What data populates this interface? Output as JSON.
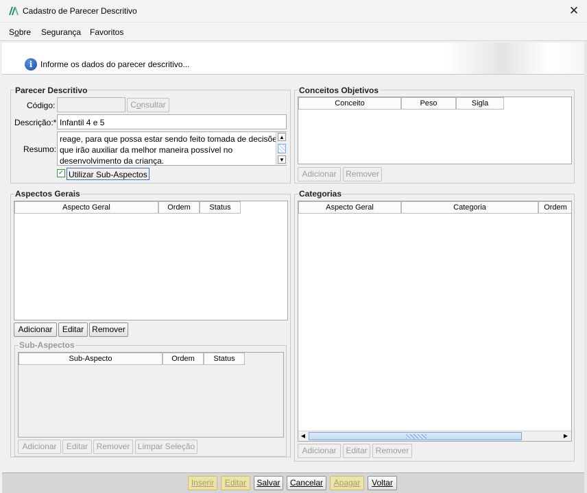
{
  "window": {
    "title": "Cadastro de Parecer Descritivo"
  },
  "menu": {
    "sobre_pre": "S",
    "sobre_ul": "o",
    "sobre_post": "bre",
    "seguranca": "Segurança",
    "favoritos": "Favoritos"
  },
  "info": {
    "text": "Informe os dados do parecer descritivo...",
    "icon_glyph": "i"
  },
  "parecer": {
    "legend": "Parecer Descritivo",
    "codigo_label": "Código:",
    "codigo_value": "",
    "consultar_pre": "C",
    "consultar_ul": "o",
    "consultar_post": "nsultar",
    "descricao_label": "Descrição:*",
    "descricao_value": "Infantil 4 e 5",
    "resumo_label": "Resumo:",
    "resumo_lines": [
      "reage, para que possa estar sendo feito tomada de decisões",
      "que irão  auxiliar da melhor maneira possível no",
      "desenvolvimento da criança."
    ],
    "checkbox_label": "Utilizar Sub-Aspectos",
    "checkbox_checked": true
  },
  "conceitos": {
    "legend": "Conceitos Objetivos",
    "columns": [
      "Conceito",
      "Peso",
      "Sigla"
    ],
    "adicionar": "Adicionar",
    "remover": "Remover"
  },
  "aspectos": {
    "legend": "Aspectos Gerais",
    "columns": [
      "Aspecto Geral",
      "Ordem",
      "Status"
    ],
    "adicionar": "Adicionar",
    "editar": "Editar",
    "remover": "Remover"
  },
  "subaspectos": {
    "legend": "Sub-Aspectos",
    "columns": [
      "Sub-Aspecto",
      "Ordem",
      "Status"
    ],
    "adicionar": "Adicionar",
    "editar": "Editar",
    "remover": "Remover",
    "limpar": "Limpar Seleção"
  },
  "categorias": {
    "legend": "Categorias",
    "columns": [
      "Aspecto Geral",
      "Categoria",
      "Ordem"
    ],
    "adicionar": "Adicionar",
    "editar": "Editar",
    "remover": "Remover"
  },
  "actions": {
    "inserir": "Inserir",
    "editar": "Editar",
    "salvar": "Salvar",
    "cancelar": "Cancelar",
    "apagar": "Apagar",
    "voltar": "Voltar"
  },
  "colors": {
    "disabled_yellow": "#ece3a8",
    "focus_border": "#3c6fc4",
    "icon_blue": "#1b4fb0",
    "logo_green": "#1f8a7a"
  }
}
